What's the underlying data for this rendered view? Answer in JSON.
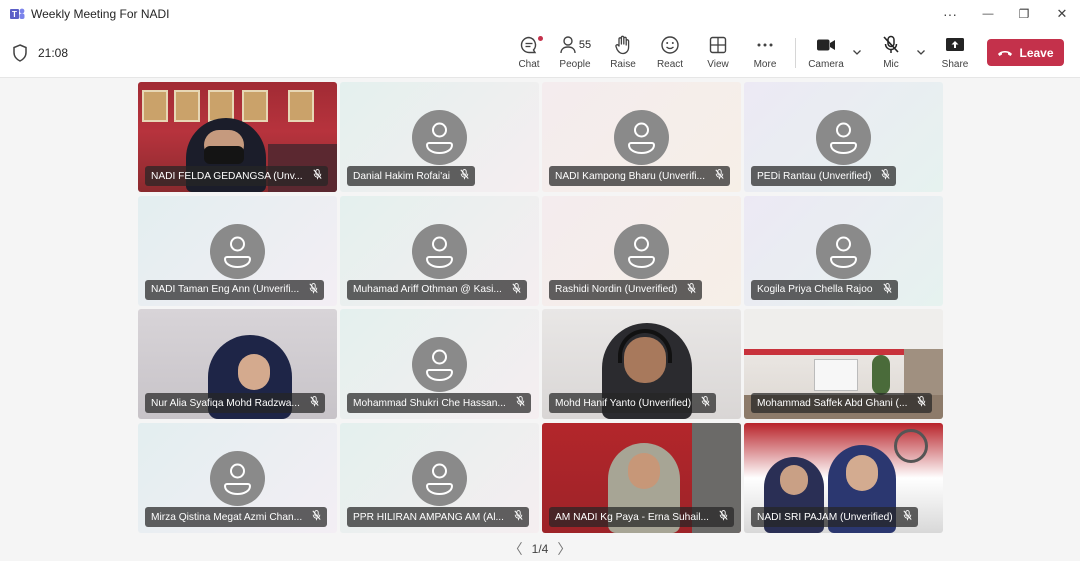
{
  "window": {
    "title": "Weekly Meeting For NADI",
    "controls": {
      "more": "···",
      "minimize": "—",
      "maximize": "❐",
      "close": "✕"
    }
  },
  "toolbar": {
    "timer": "21:08",
    "buttons": {
      "chat": "Chat",
      "people": "People",
      "people_count": "55",
      "raise": "Raise",
      "react": "React",
      "view": "View",
      "more": "More",
      "camera": "Camera",
      "mic": "Mic",
      "share": "Share"
    },
    "leave": "Leave"
  },
  "participants": [
    {
      "name": "NADI FELDA GEDANGSA (Unv...",
      "video": true,
      "scene": "v0"
    },
    {
      "name": "Danial Hakim Rofai'ai",
      "video": false,
      "bg": "blank-1"
    },
    {
      "name": "NADI Kampong Bharu (Unverifi...",
      "video": false,
      "bg": "blank-2"
    },
    {
      "name": "PEDi Rantau (Unverified)",
      "video": false,
      "bg": "blank-3"
    },
    {
      "name": "NADI Taman Eng Ann (Unverifi...",
      "video": false,
      "bg": "blank-0"
    },
    {
      "name": "Muhamad Ariff Othman @ Kasi...",
      "video": false,
      "bg": "blank-1"
    },
    {
      "name": "Rashidi Nordin (Unverified)",
      "video": false,
      "bg": "blank-2"
    },
    {
      "name": "Kogila Priya Chella Rajoo",
      "video": false,
      "bg": "blank-3"
    },
    {
      "name": "Nur Alia Syafiqa Mohd Radzwa...",
      "video": true,
      "scene": "v8"
    },
    {
      "name": "Mohammad Shukri Che Hassan...",
      "video": false,
      "bg": "blank-1"
    },
    {
      "name": "Mohd Hanif Yanto (Unverified)",
      "video": true,
      "scene": "v10"
    },
    {
      "name": "Mohammad Saffek Abd Ghani (...",
      "video": true,
      "scene": "v11"
    },
    {
      "name": "Mirza Qistina Megat Azmi Chan...",
      "video": false,
      "bg": "blank-0"
    },
    {
      "name": "PPR HILIRAN AMPANG AM (Al...",
      "video": false,
      "bg": "blank-1"
    },
    {
      "name": "AM NADI Kg Paya - Erna Suhail...",
      "video": true,
      "scene": "v14"
    },
    {
      "name": "NADI SRI PAJAM (Unverified)",
      "video": true,
      "scene": "v15"
    }
  ],
  "pager": {
    "page": "1/4",
    "prev": "〈",
    "next": "〉"
  },
  "colors": {
    "leave": "#c4314b",
    "accent": "#6264a7"
  }
}
